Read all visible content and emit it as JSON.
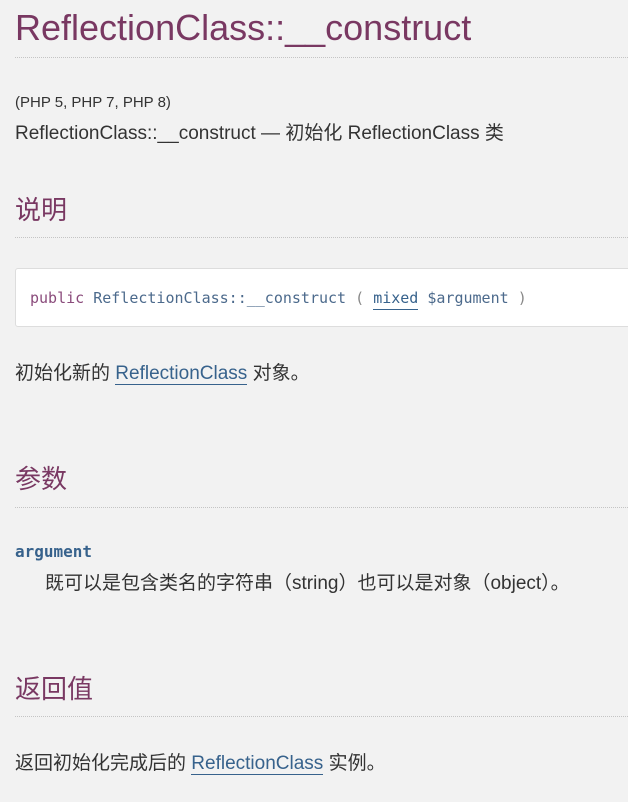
{
  "page_title": "ReflectionClass::__construct",
  "versions": "(PHP 5, PHP 7, PHP 8)",
  "refpurpose": {
    "name": "ReflectionClass::__construct",
    "dash": " — ",
    "text": "初始化 ReflectionClass 类"
  },
  "description": {
    "heading": "说明",
    "synopsis": {
      "modifier": "public",
      "method": "ReflectionClass::__construct",
      "open_paren": "(",
      "param_type": "mixed",
      "param_var": "$argument",
      "close_paren": ")"
    },
    "text_before": "初始化新的",
    "link": "ReflectionClass",
    "text_after": "对象。"
  },
  "parameters": {
    "heading": "参数",
    "items": [
      {
        "name": "argument",
        "description": "既可以是包含类名的字符串（string）也可以是对象（object）。"
      }
    ]
  },
  "return_values": {
    "heading": "返回值",
    "text_before": "返回初始化完成后的",
    "link": "ReflectionClass",
    "text_after": "实例。"
  },
  "colors": {
    "heading": "#793862",
    "link": "#37628c",
    "text": "#333333",
    "background": "#f2f2f2"
  }
}
